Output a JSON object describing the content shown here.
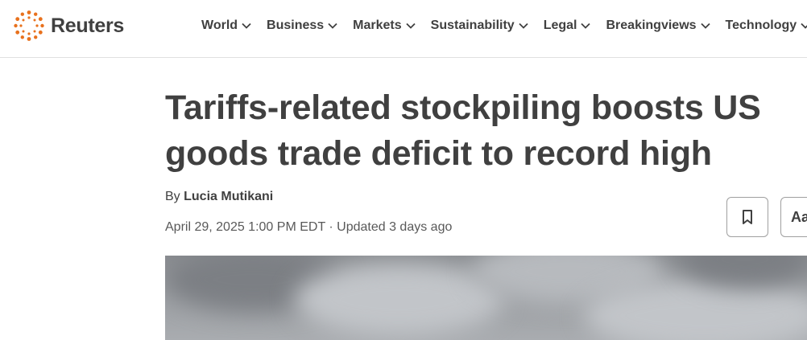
{
  "brand": {
    "name": "Reuters",
    "logo_color": "#e8711d"
  },
  "nav": {
    "items": [
      {
        "label": "World"
      },
      {
        "label": "Business"
      },
      {
        "label": "Markets"
      },
      {
        "label": "Sustainability"
      },
      {
        "label": "Legal"
      },
      {
        "label": "Breakingviews"
      },
      {
        "label": "Technology"
      }
    ]
  },
  "article": {
    "headline_line1": "Tariffs-related stockpiling boosts US",
    "headline_line2": "goods trade deficit to record high",
    "by_prefix": "By",
    "author": "Lucia Mutikani",
    "dateline": "April 29, 2025 1:00 PM EDT · Updated 3 days ago"
  },
  "actions": {
    "bookmark_icon": "bookmark-icon",
    "text_size_label": "Aa"
  },
  "hero_image": {
    "description_colors": [
      "#8a8d91",
      "#c2c5c9"
    ]
  }
}
